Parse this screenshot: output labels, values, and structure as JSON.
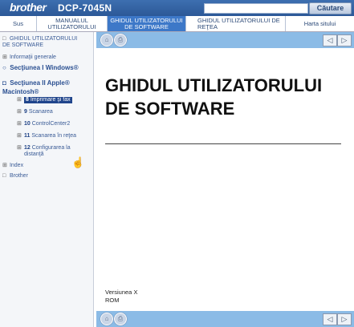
{
  "header": {
    "brand": "brother",
    "model": "DCP-7045N",
    "search_placeholder": "",
    "search_button": "Căutare"
  },
  "tabs": [
    {
      "label": "Sus"
    },
    {
      "label": "MANUALUL UTILIZATORULUI"
    },
    {
      "label": "GHIDUL UTILIZATORULUI DE SOFTWARE"
    },
    {
      "label": "GHIDUL UTILIZATORULUI DE REŢEA"
    },
    {
      "label": "Harta sitului"
    }
  ],
  "sidebar": {
    "items": [
      {
        "label": "GHIDUL UTILIZATORULUI DE SOFTWARE"
      },
      {
        "label": "Informaţii generale"
      },
      {
        "label": "Secţiunea I Windows®"
      },
      {
        "label": "Secţiunea II Apple® Macintosh®"
      },
      {
        "num": "8",
        "label": "Imprimare şi fax"
      },
      {
        "num": "9",
        "label": "Scanarea"
      },
      {
        "num": "10",
        "label": "ControlCenter2"
      },
      {
        "num": "11",
        "label": "Scanarea în reţea"
      },
      {
        "num": "12",
        "label": "Configurarea la distanţă"
      },
      {
        "label": "Index"
      },
      {
        "label": "Brother"
      }
    ]
  },
  "content": {
    "title": "GHIDUL UTILIZATORULUI DE SOFTWARE",
    "version": "Versiunea X",
    "lang": "ROM"
  }
}
